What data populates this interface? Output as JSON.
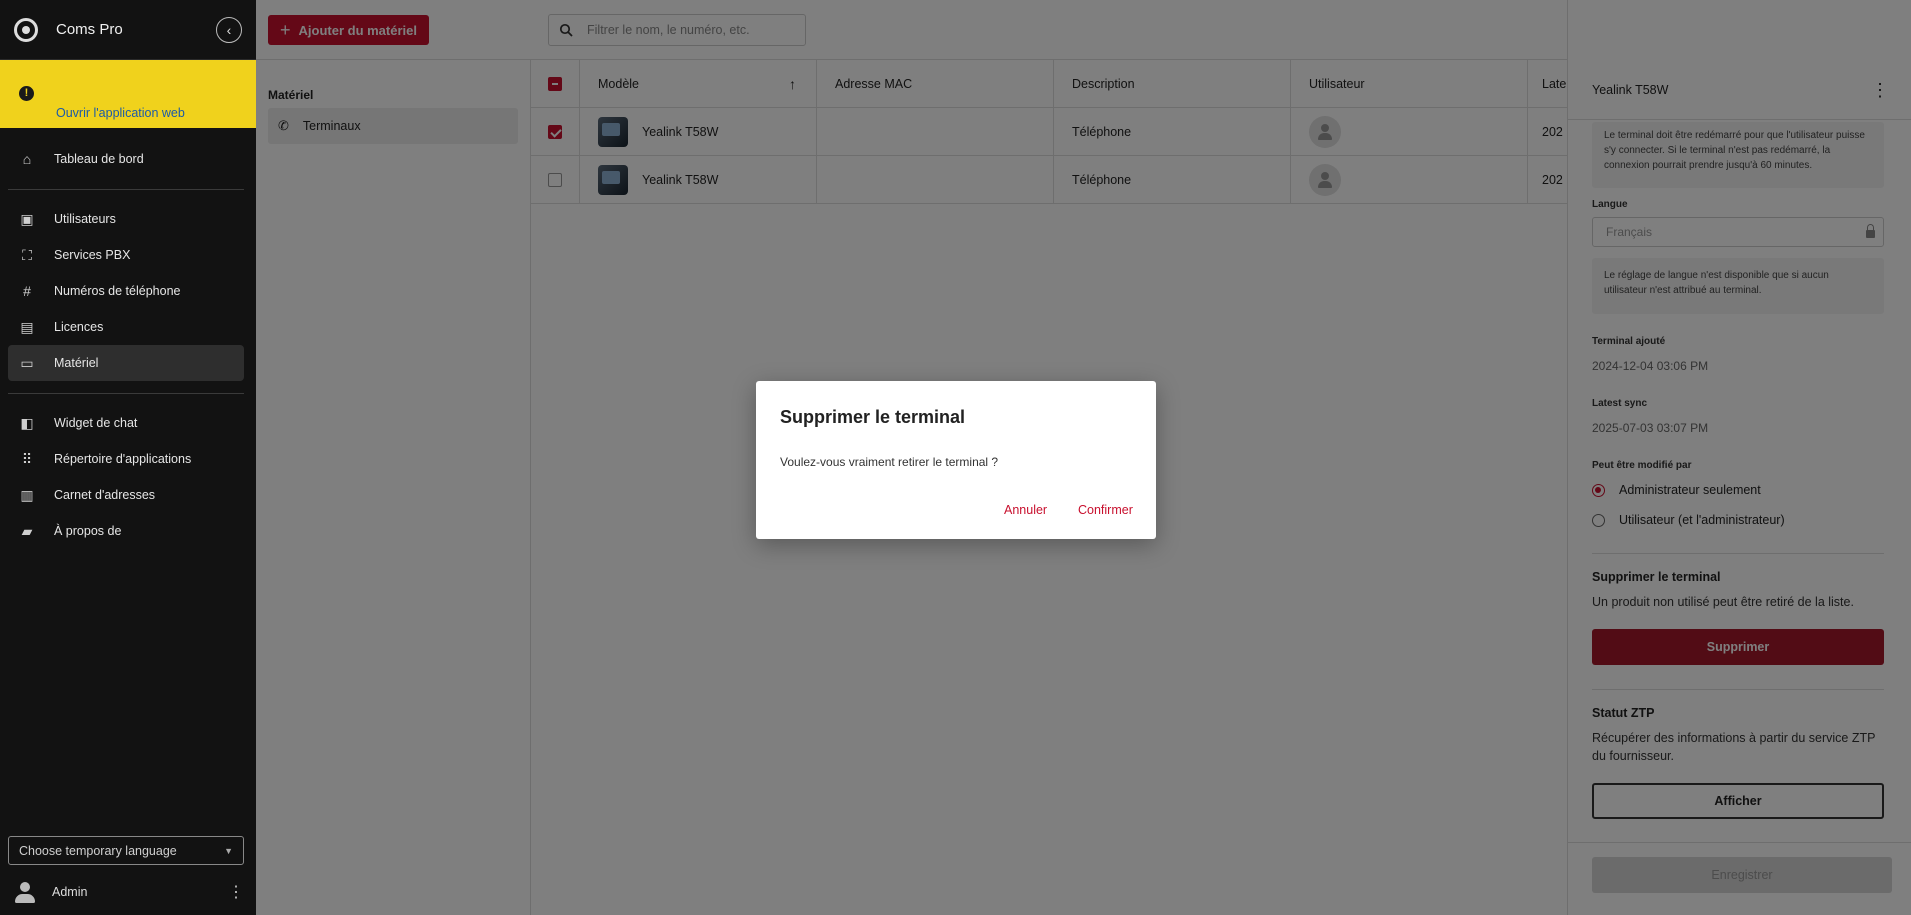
{
  "sidebar": {
    "app_title": "Coms Pro",
    "banner_link": "Ouvrir l'application web",
    "items_group1": [
      {
        "label": "Tableau de bord",
        "icon": "home-icon"
      }
    ],
    "items_group2": [
      {
        "label": "Utilisateurs",
        "icon": "person-box-icon"
      },
      {
        "label": "Services PBX",
        "icon": "hierarchy-icon"
      },
      {
        "label": "Numéros de téléphone",
        "icon": "hash-icon"
      },
      {
        "label": "Licences",
        "icon": "id-card-icon"
      },
      {
        "label": "Matériel",
        "icon": "devices-icon"
      }
    ],
    "items_group3": [
      {
        "label": "Widget de chat",
        "icon": "widgets-icon"
      },
      {
        "label": "Répertoire d'applications",
        "icon": "apps-grid-icon"
      },
      {
        "label": "Carnet d'adresses",
        "icon": "contacts-icon"
      },
      {
        "label": "À propos de",
        "icon": "briefcase-icon"
      }
    ],
    "language_select": "Choose temporary language",
    "user_name": "Admin"
  },
  "topbar": {
    "add_button": "Ajouter du matériel",
    "search_placeholder": "Filtrer le nom, le numéro, etc."
  },
  "subnav": {
    "title": "Matériel",
    "item": "Terminaux"
  },
  "table": {
    "columns": [
      "Modèle",
      "Adresse MAC",
      "Description",
      "Utilisateur",
      "Late"
    ],
    "rows": [
      {
        "model": "Yealink T58W",
        "mac": "",
        "description": "Téléphone",
        "last": "202",
        "checked": true
      },
      {
        "model": "Yealink T58W",
        "mac": "",
        "description": "Téléphone",
        "last": "202",
        "checked": false
      }
    ]
  },
  "panel": {
    "title": "Yealink T58W",
    "restart_info": "Le terminal doit être redémarré pour que l'utilisateur puisse s'y connecter. Si le terminal n'est pas redémarré, la connexion pourrait prendre jusqu'à 60 minutes.",
    "language_label": "Langue",
    "language_value": "Français",
    "language_info": "Le réglage de langue n'est disponible que si aucun utilisateur n'est attribué au terminal.",
    "added_label": "Terminal ajouté",
    "added_value": "2024-12-04 03:06 PM",
    "sync_label": "Latest sync",
    "sync_value": "2025-07-03 03:07 PM",
    "editable_label": "Peut être modifié par",
    "radio_admin": "Administrateur seulement",
    "radio_user": "Utilisateur (et l'administrateur)",
    "delete_title": "Supprimer le terminal",
    "delete_text": "Un produit non utilisé peut être retiré de la liste.",
    "delete_button": "Supprimer",
    "ztp_title": "Statut ZTP",
    "ztp_text": "Récupérer des informations à partir du service ZTP du fournisseur.",
    "show_button": "Afficher",
    "save_button": "Enregistrer"
  },
  "dialog": {
    "title": "Supprimer le terminal",
    "text": "Voulez-vous vraiment retirer le terminal ?",
    "cancel": "Annuler",
    "confirm": "Confirmer"
  },
  "colors": {
    "accent": "#c8102e",
    "banner": "#f0d21c",
    "sidebar_bg": "#121212"
  }
}
